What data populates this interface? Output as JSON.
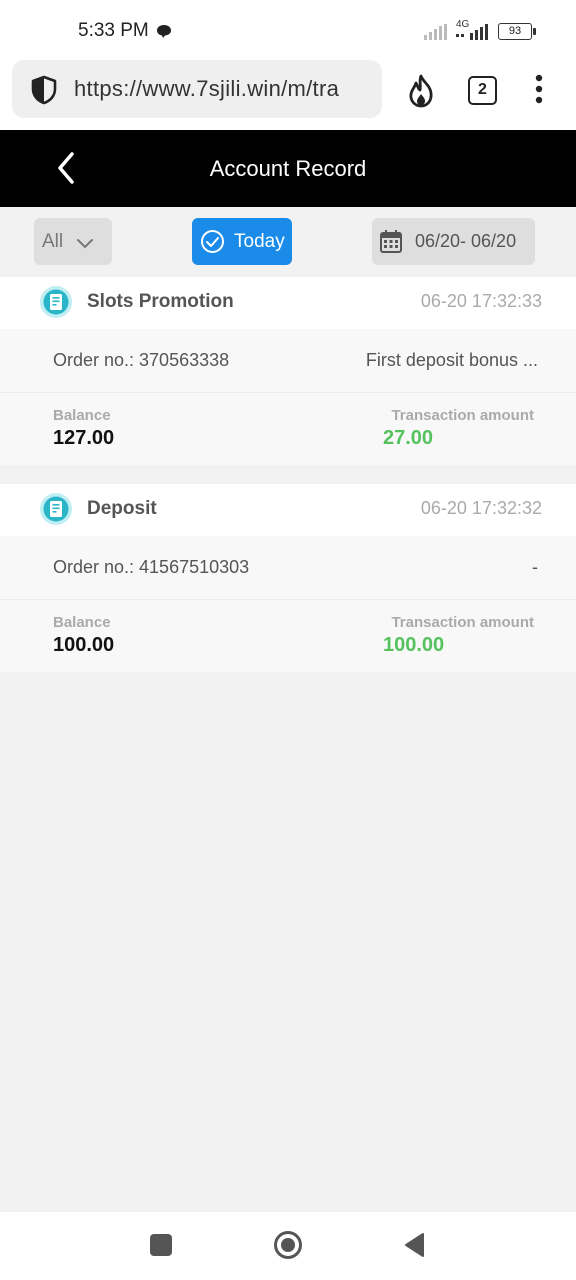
{
  "status_bar": {
    "time": "5:33 PM",
    "network": "4G",
    "battery": "93"
  },
  "browser": {
    "url": "https://www.7sjili.win/m/tra",
    "tab_count": "2"
  },
  "header": {
    "title": "Account Record"
  },
  "filters": {
    "type_label": "All",
    "today_label": "Today",
    "date_range": "06/20- 06/20",
    "accent_color": "#1a8be8"
  },
  "labels": {
    "balance": "Balance",
    "transaction_amount": "Transaction amount"
  },
  "records": [
    {
      "type": "Slots Promotion",
      "time": "06-20 17:32:33",
      "order": "Order no.: 370563338",
      "description": "First deposit bonus ...",
      "balance": "127.00",
      "amount": "27.00"
    },
    {
      "type": "Deposit",
      "time": "06-20 17:32:32",
      "order": "Order no.: 41567510303",
      "description": "-",
      "balance": "100.00",
      "amount": "100.00"
    }
  ],
  "colors": {
    "amount_positive": "#55c25f",
    "icon_teal": "#2bb5c9"
  }
}
